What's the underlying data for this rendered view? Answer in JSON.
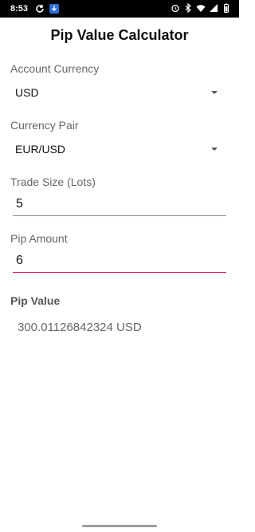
{
  "status_bar": {
    "time": "8:53",
    "left_icons": [
      "sync-icon",
      "download-icon"
    ],
    "right_icons": [
      "alarm-icon",
      "bluetooth-icon",
      "wifi-icon",
      "signal-icon",
      "battery-icon"
    ]
  },
  "title": "Pip Value Calculator",
  "account_currency": {
    "label": "Account Currency",
    "value": "USD"
  },
  "currency_pair": {
    "label": "Currency Pair",
    "value": "EUR/USD"
  },
  "trade_size": {
    "label": "Trade Size (Lots)",
    "value": "5"
  },
  "pip_amount": {
    "label": "Pip Amount",
    "value": "6"
  },
  "result": {
    "label": "Pip Value",
    "value": "300.01126842324 USD"
  },
  "colors": {
    "accent": "#d81b60",
    "status_bar": "#000000"
  }
}
